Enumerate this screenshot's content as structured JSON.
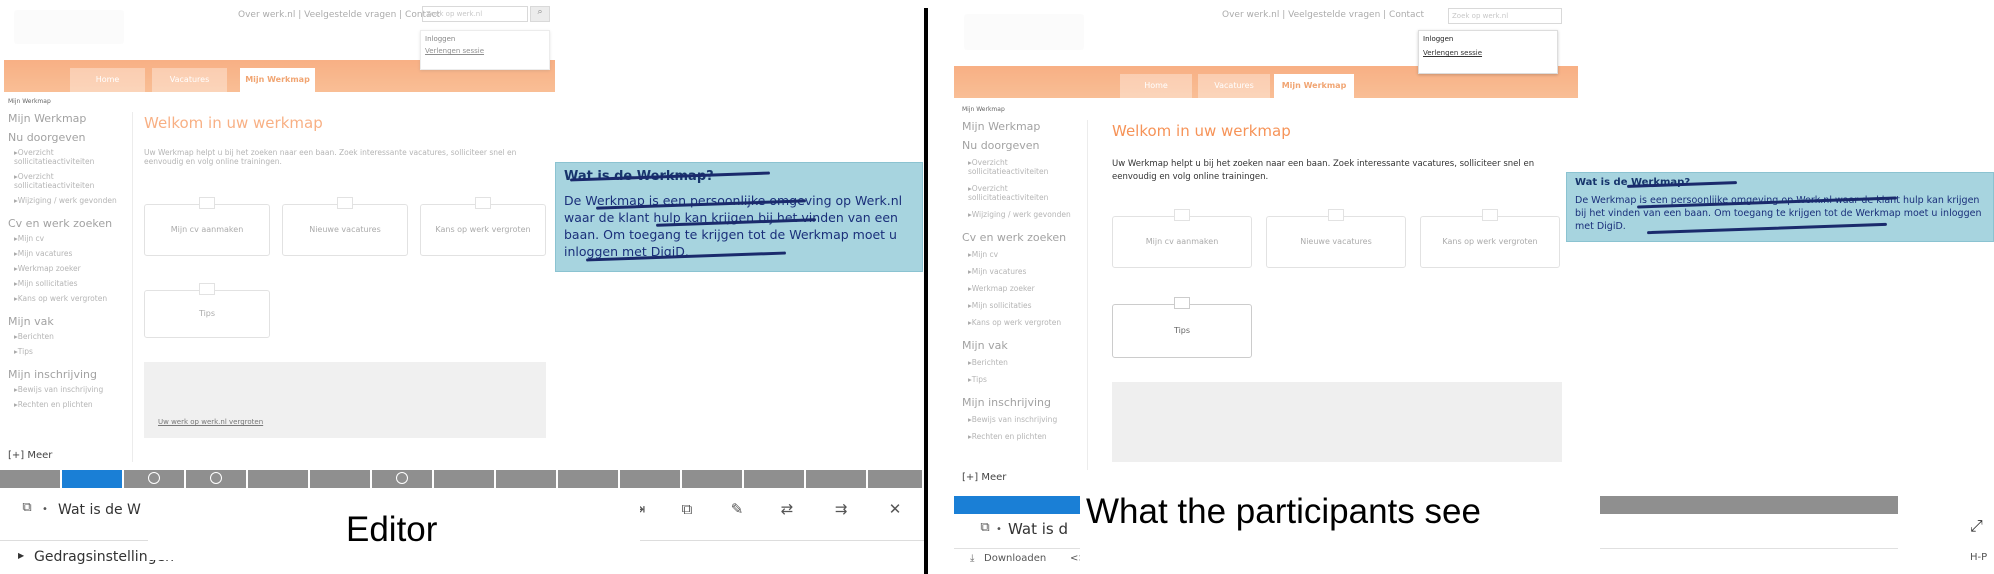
{
  "site": {
    "top_nav": "Over werk.nl | Veelgestelde vragen | Contact",
    "top_nav_right": "Over werk.nl | Veelgestelde vragen | Contact",
    "search_placeholder": "Zoek op werk.nl",
    "login_popup_line": "Inloggen",
    "login_popup_link": "Verlengen sessie",
    "tabs": [
      "Home",
      "Vacatures",
      "Mijn Werkmap"
    ],
    "breadcrumb": "Mijn Werkmap",
    "welcome_title": "Welkom in uw werkmap",
    "intro_left": "Uw Werkmap helpt u bij het zoeken naar een baan. Zoek interessante vacatures, solliciteer snel en eenvoudig en volg online trainingen.",
    "intro_right": "Uw Werkmap helpt u bij het zoeken naar een baan. Zoek interessante vacatures, solliciteer snel en eenvoudig en volg online trainingen.",
    "sidebar_left": [
      {
        "heading": "Mijn Werkmap",
        "items": []
      },
      {
        "heading": "Nu doorgeven",
        "items": [
          "Overzicht sollicitatieactiviteiten",
          "Overzicht sollicitatieactiviteiten",
          "Wijziging / werk gevonden"
        ]
      },
      {
        "heading": "Cv en werk zoeken",
        "items": [
          "Mijn cv",
          "Mijn vacatures",
          "Werkmap zoeker",
          "Mijn sollicitaties",
          "Kans op werk vergroten"
        ]
      },
      {
        "heading": "Mijn vak",
        "items": [
          "Berichten",
          "Tips"
        ]
      },
      {
        "heading": "Mijn inschrijving",
        "items": [
          "Bewijs van inschrijving",
          "Rechten en plichten"
        ]
      }
    ],
    "sidebar_right": [
      {
        "heading": "Mijn Werkmap",
        "items": []
      },
      {
        "heading": "Nu doorgeven",
        "items": [
          "Overzicht sollicitatieactiviteiten",
          "Overzicht sollicitatieactiviteiten",
          "Wijziging / werk gevonden"
        ]
      },
      {
        "heading": "Cv en werk zoeken",
        "items": [
          "Mijn cv",
          "Mijn vacatures",
          "Werkmap zoeker",
          "Mijn sollicitaties",
          "Kans op werk vergroten"
        ]
      },
      {
        "heading": "Mijn vak",
        "items": [
          "Berichten",
          "Tips"
        ]
      },
      {
        "heading": "Mijn inschrijving",
        "items": [
          "Bewijs van inschrijving",
          "Rechten en plichten"
        ]
      }
    ],
    "more_link": "[+] Meer",
    "tiles_left": [
      "Mijn cv aanmaken",
      "Nieuwe vacatures",
      "Kans op werk vergroten",
      "Tips"
    ],
    "tiles_right": [
      "Mijn cv aanmaken",
      "Nieuwe vacatures",
      "Kans op werk vergroten",
      "Tips"
    ],
    "panel_link": "Uw werk op werk.nl vergroten"
  },
  "tooltip_left": {
    "title": "Wat is de Werkmap?",
    "body": "De Werkmap is een persoonlijke omgeving op Werk.nl waar de klant hulp kan krijgen bij het vinden van een baan. Om toegang te krijgen tot de Werkmap moet u inloggen met DigiD."
  },
  "tooltip_right": {
    "title": "Wat is de Werkmap?",
    "body": "De Werkmap is een persoonlijke omgeving op Werk.nl waar de klant hulp kan krijgen bij het vinden van een baan. Om toegang te krijgen tot de Werkmap moet u inloggen met DigiD."
  },
  "editor": {
    "step_title": "Wat is de W",
    "behavior_settings": "Gedragsinstellingen"
  },
  "participant": {
    "step_title": "Wat is d",
    "download": "Downloaden",
    "code_btn": "<>",
    "right_label": "H-P"
  },
  "captions": {
    "editor": "Editor",
    "participants": "What the participants see"
  },
  "colors": {
    "brand_orange": "#f37021",
    "tooltip_bg": "#a7d4df",
    "tooltip_text": "#17356c",
    "timeline_active": "#1a7fd6",
    "timeline_gray": "#8f8f8f"
  }
}
